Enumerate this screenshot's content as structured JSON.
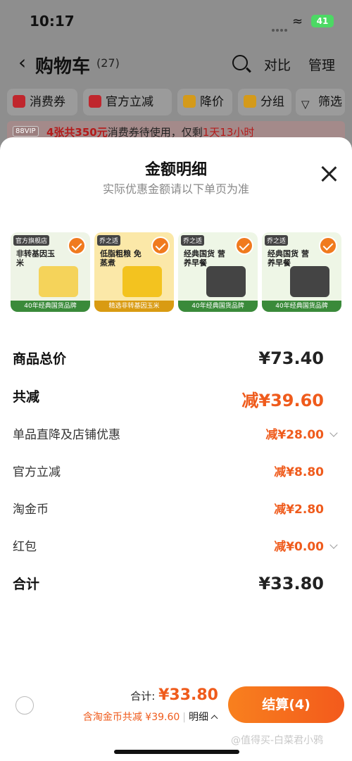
{
  "status": {
    "time": "10:17",
    "battery": "41"
  },
  "nav": {
    "title": "购物车",
    "count": "(27)",
    "compare": "对比",
    "manage": "管理"
  },
  "chips": [
    "消费券",
    "官方立减",
    "降价",
    "分组",
    "筛选"
  ],
  "vip": {
    "badge": "88VIP",
    "part1": "4张共350元",
    "part2": "消费券待使用，仅剩",
    "part3": "1天13小时"
  },
  "sheet": {
    "title": "金额明细",
    "subtitle": "实际优惠金额请以下单页为准",
    "products": [
      {
        "shop": "官方旗舰店",
        "title": "非转基因玉米",
        "footer": "40年经典国货品牌",
        "color": "#eef4e6",
        "mid": "#f5d35a",
        "foot": "#3a8a3a"
      },
      {
        "shop": "乔之适",
        "title": "低脂粗粮 免蒸煮",
        "footer": "精选非转基因玉米",
        "color": "#fbe8a8",
        "mid": "#f3c31f",
        "foot": "#d99b12"
      },
      {
        "shop": "乔之适",
        "title": "经典国货 营养早餐",
        "footer": "40年经典国货品牌",
        "color": "#eef6e6",
        "mid": "#444444",
        "foot": "#3a8a3a"
      },
      {
        "shop": "乔之适",
        "title": "经典国货 营养早餐",
        "footer": "40年经典国货品牌",
        "color": "#eef6e6",
        "mid": "#444444",
        "foot": "#3a8a3a"
      }
    ],
    "rows": [
      {
        "label": "商品总价",
        "value": "¥73.40"
      },
      {
        "label": "共减",
        "value": "减¥39.60"
      },
      {
        "label": "单品直降及店铺优惠",
        "value": "减¥28.00"
      },
      {
        "label": "官方立减",
        "value": "减¥8.80"
      },
      {
        "label": "淘金币",
        "value": "减¥2.80"
      },
      {
        "label": "红包",
        "value": "减¥0.00"
      },
      {
        "label": "合计",
        "value": "¥33.80"
      }
    ]
  },
  "bottom": {
    "total_label": "合计:",
    "total_value": "¥33.80",
    "coin_text": "含淘金币共减 ¥39.60",
    "detail_label": "明细",
    "checkout": "结算(4)",
    "watermark": "@值得买-白菜君小鸦"
  },
  "colors": {
    "accent": "#ef5b1c",
    "checkout_start": "#f8801e"
  }
}
